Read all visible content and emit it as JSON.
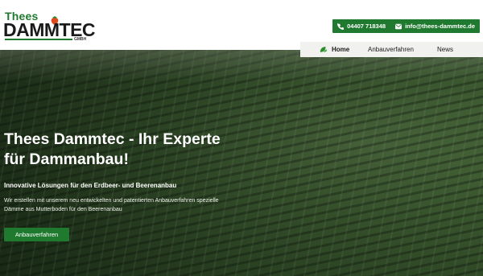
{
  "logo": {
    "top": "Thees",
    "main": "DAMMTEC",
    "sub": "GMBH"
  },
  "contact": {
    "phone": "04407 718348",
    "email": "info@thees-dammtec.de"
  },
  "nav": {
    "items": [
      {
        "label": "Home",
        "icon": "leaf-icon",
        "active": true
      },
      {
        "label": "Anbauverfahren"
      },
      {
        "label": "News"
      }
    ]
  },
  "hero": {
    "title": "Thees Dammtec - Ihr Experte für Dammanbau!",
    "subtitle": "Innovative Lösungen für den Erdbeer- und Beerenanbau",
    "text": "Wir erstellen mit unserem neu entwickelten und patentierten Anbauverfahren spezielle Dämme aus Mutterboden für den Beerenanbau",
    "button": "Anbauverfahren"
  },
  "colors": {
    "brand_green": "#1f7a2f",
    "nav_bg": "#f1f1ef"
  }
}
